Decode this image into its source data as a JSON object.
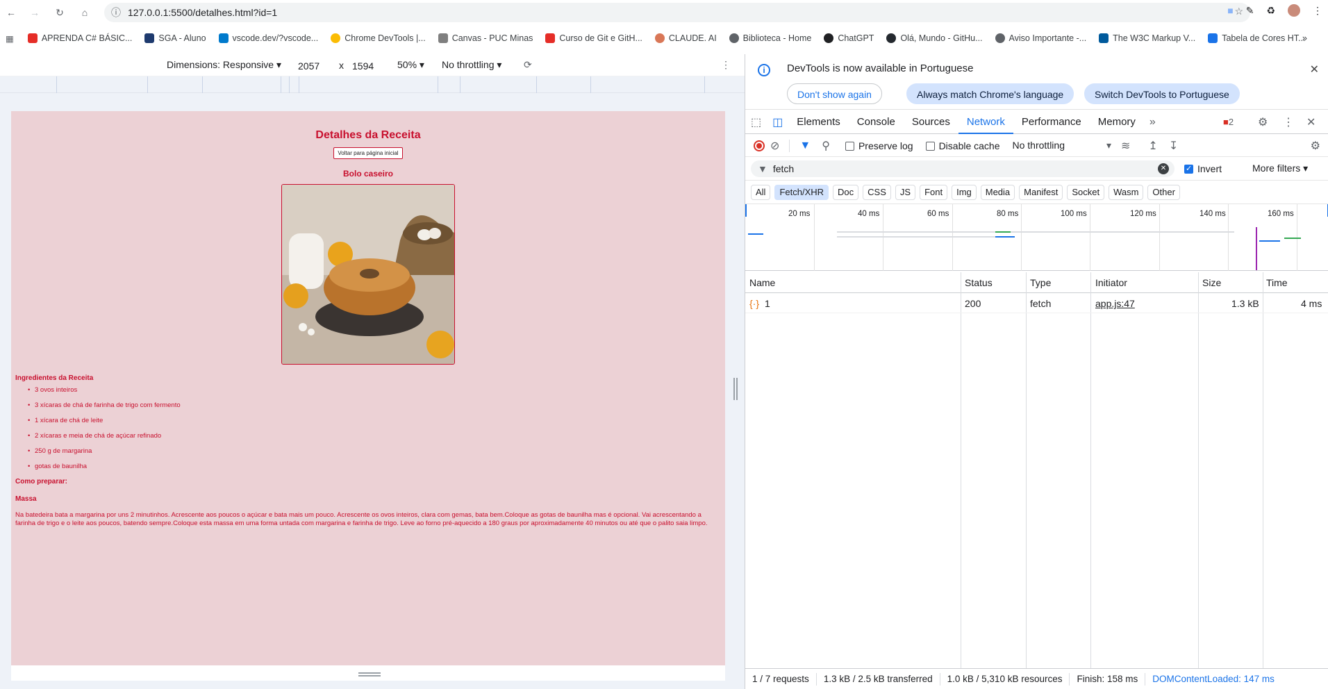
{
  "browser": {
    "url": "127.0.0.1:5500/detalhes.html?id=1",
    "bookmarks": [
      {
        "label": "APRENDA C# BÁSIC...",
        "color": "#e52d27"
      },
      {
        "label": "SGA - Aluno",
        "color": "#1e3a6e"
      },
      {
        "label": "vscode.dev/?vscode...",
        "color": "#007acc"
      },
      {
        "label": "Chrome DevTools |...",
        "color": "#fbbc04"
      },
      {
        "label": "Canvas - PUC Minas",
        "color": "#7f7f7f"
      },
      {
        "label": "Curso de Git e GitH...",
        "color": "#e52d27"
      },
      {
        "label": "CLAUDE. AI",
        "color": "#d97757"
      },
      {
        "label": "Biblioteca - Home",
        "color": "#5f6368"
      },
      {
        "label": "ChatGPT",
        "color": "#202124"
      },
      {
        "label": "Olá, Mundo - GitHu...",
        "color": "#24292f"
      },
      {
        "label": "Aviso Importante -...",
        "color": "#5f6368"
      },
      {
        "label": "The W3C Markup V...",
        "color": "#005a9c"
      },
      {
        "label": "Tabela de Cores HT...",
        "color": "#1a73e8"
      }
    ]
  },
  "device_toolbar": {
    "dimensions_label": "Dimensions: Responsive",
    "width": "2057",
    "times": "x",
    "height": "1594",
    "zoom": "50%",
    "throttling": "No throttling"
  },
  "page": {
    "title": "Detalhes da Receita",
    "back_button": "Voltar para página inicial",
    "recipe_name": "Bolo caseiro",
    "ingredients_title": "Ingredientes da Receita",
    "ingredients": [
      "3 ovos inteiros",
      "3 xícaras de chá de farinha de trigo com fermento",
      "1 xícara de chá de leite",
      "2 xícaras e meia de chá de açúcar refinado",
      "250 g de margarina",
      "gotas de baunilha"
    ],
    "how_title": "Como preparar:",
    "massa_title": "Massa",
    "instructions": "Na batedeira bata a margarina por uns 2 minutinhos. Acrescente aos poucos o açúcar e bata mais um pouco. Acrescente os ovos inteiros, clara com gemas, bata bem.Coloque as gotas de baunilha mas é opcional. Vai acrescentando a farinha de trigo e o leite aos poucos, batendo sempre.Coloque esta massa em uma forma untada com margarina e farinha de trigo. Leve ao forno pré-aquecido a 180 graus por aproximadamente 40 minutos ou até que o palito saia limpo."
  },
  "devtools": {
    "infobar": {
      "message": "DevTools is now available in Portuguese",
      "btn_dont_show": "Don't show again",
      "btn_match": "Always match Chrome's language",
      "btn_switch": "Switch DevTools to Portuguese"
    },
    "tabs": [
      "Elements",
      "Console",
      "Sources",
      "Network",
      "Performance",
      "Memory"
    ],
    "error_count": "2",
    "network": {
      "preserve_log": "Preserve log",
      "disable_cache": "Disable cache",
      "throttling": "No throttling",
      "filter_value": "fetch",
      "invert": "Invert",
      "more_filters": "More filters",
      "types": [
        "All",
        "Fetch/XHR",
        "Doc",
        "CSS",
        "JS",
        "Font",
        "Img",
        "Media",
        "Manifest",
        "Socket",
        "Wasm",
        "Other"
      ],
      "timeline_labels": [
        "20 ms",
        "40 ms",
        "60 ms",
        "80 ms",
        "100 ms",
        "120 ms",
        "140 ms",
        "160 ms"
      ],
      "columns": [
        "Name",
        "Status",
        "Type",
        "Initiator",
        "Size",
        "Time"
      ],
      "rows": [
        {
          "name": "1",
          "status": "200",
          "type": "fetch",
          "initiator": "app.js:47",
          "size": "1.3 kB",
          "time": "4 ms"
        }
      ],
      "status_bar": {
        "requests": "1 / 7 requests",
        "transferred": "1.3 kB / 2.5 kB transferred",
        "resources": "1.0 kB / 5,310 kB resources",
        "finish": "Finish: 158 ms",
        "dcl": "DOMContentLoaded: 147 ms"
      }
    }
  }
}
